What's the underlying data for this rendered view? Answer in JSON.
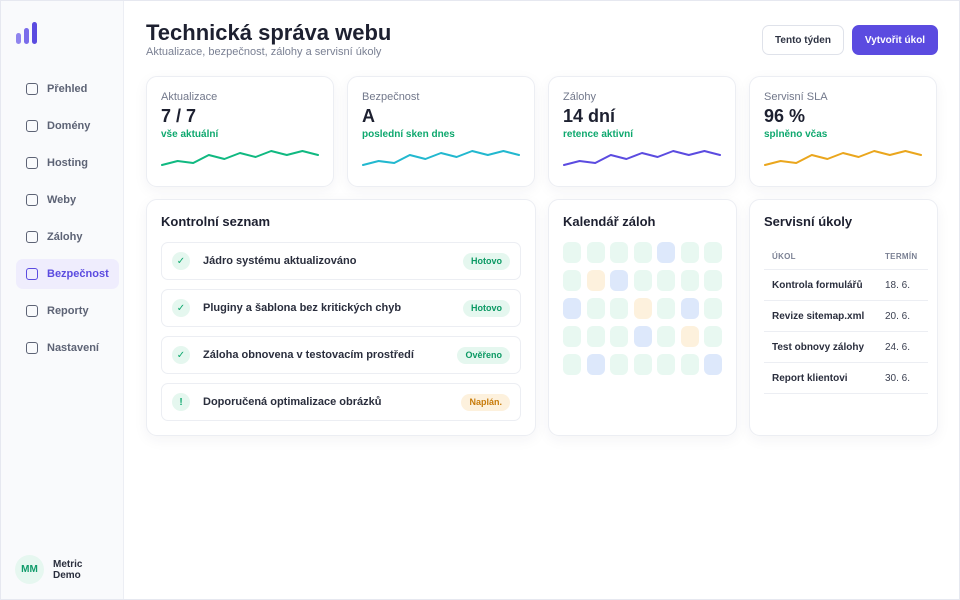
{
  "sidebar": {
    "items": [
      {
        "label": "Přehled",
        "active": false
      },
      {
        "label": "Domény",
        "active": false
      },
      {
        "label": "Hosting",
        "active": false
      },
      {
        "label": "Weby",
        "active": false
      },
      {
        "label": "Zálohy",
        "active": false
      },
      {
        "label": "Bezpečnost",
        "active": true
      },
      {
        "label": "Reporty",
        "active": false
      },
      {
        "label": "Nastavení",
        "active": false
      }
    ],
    "user": {
      "initials": "MM",
      "name": "Metric Demo"
    }
  },
  "header": {
    "title": "Technická správa webu",
    "subtitle": "Aktualizace, bezpečnost, zálohy a servisní úkoly",
    "secondary_button": "Tento týden",
    "primary_button": "Vytvořit úkol"
  },
  "stats": [
    {
      "label": "Aktualizace",
      "value": "7 / 7",
      "note": "vše aktuální",
      "color": "#10b981",
      "trend": [
        3,
        5,
        4,
        8,
        6,
        9,
        7,
        10,
        8,
        10,
        8
      ]
    },
    {
      "label": "Bezpečnost",
      "value": "A",
      "note": "poslední sken dnes",
      "color": "#22b8cf",
      "trend": [
        3,
        5,
        4,
        8,
        6,
        9,
        7,
        10,
        8,
        10,
        8
      ]
    },
    {
      "label": "Zálohy",
      "value": "14 dní",
      "note": "retence aktivní",
      "color": "#5b4be0",
      "trend": [
        3,
        5,
        4,
        8,
        6,
        9,
        7,
        10,
        8,
        10,
        8
      ]
    },
    {
      "label": "Servisní SLA",
      "value": "96 %",
      "note": "splněno včas",
      "color": "#eaa61d",
      "trend": [
        3,
        5,
        4,
        8,
        6,
        9,
        7,
        10,
        8,
        10,
        8
      ]
    }
  ],
  "checklist": {
    "title": "Kontrolní seznam",
    "items": [
      {
        "icon": "✓",
        "text": "Jádro systému aktualizováno",
        "status": "Hotovo",
        "tone": "green"
      },
      {
        "icon": "✓",
        "text": "Pluginy a šablona bez kritických chyb",
        "status": "Hotovo",
        "tone": "green"
      },
      {
        "icon": "✓",
        "text": "Záloha obnovena v testovacím prostředí",
        "status": "Ověřeno",
        "tone": "green"
      },
      {
        "icon": "!",
        "text": "Doporučená optimalizace obrázků",
        "status": "Naplán.",
        "tone": "orange"
      }
    ]
  },
  "calendar": {
    "title": "Kalendář záloh",
    "colors": {
      "ok": "#e8f8f1",
      "backup": "#dde8fb",
      "warn": "#fdf1dd"
    },
    "weeks": [
      [
        "ok",
        "ok",
        "ok",
        "ok",
        "backup",
        "ok",
        "ok"
      ],
      [
        "ok",
        "warn",
        "backup",
        "ok",
        "ok",
        "ok",
        "ok"
      ],
      [
        "backup",
        "ok",
        "ok",
        "warn",
        "ok",
        "backup",
        "ok"
      ],
      [
        "ok",
        "ok",
        "ok",
        "backup",
        "ok",
        "warn",
        "ok"
      ],
      [
        "ok",
        "backup",
        "ok",
        "ok",
        "ok",
        "ok",
        "backup"
      ]
    ]
  },
  "tasks": {
    "title": "Servisní úkoly",
    "col_task": "ÚKOL",
    "col_date": "TERMÍN",
    "rows": [
      {
        "name": "Kontrola formulářů",
        "date": "18. 6."
      },
      {
        "name": "Revize sitemap.xml",
        "date": "20. 6."
      },
      {
        "name": "Test obnovy zálohy",
        "date": "24. 6."
      },
      {
        "name": "Report klientovi",
        "date": "30. 6."
      }
    ]
  }
}
